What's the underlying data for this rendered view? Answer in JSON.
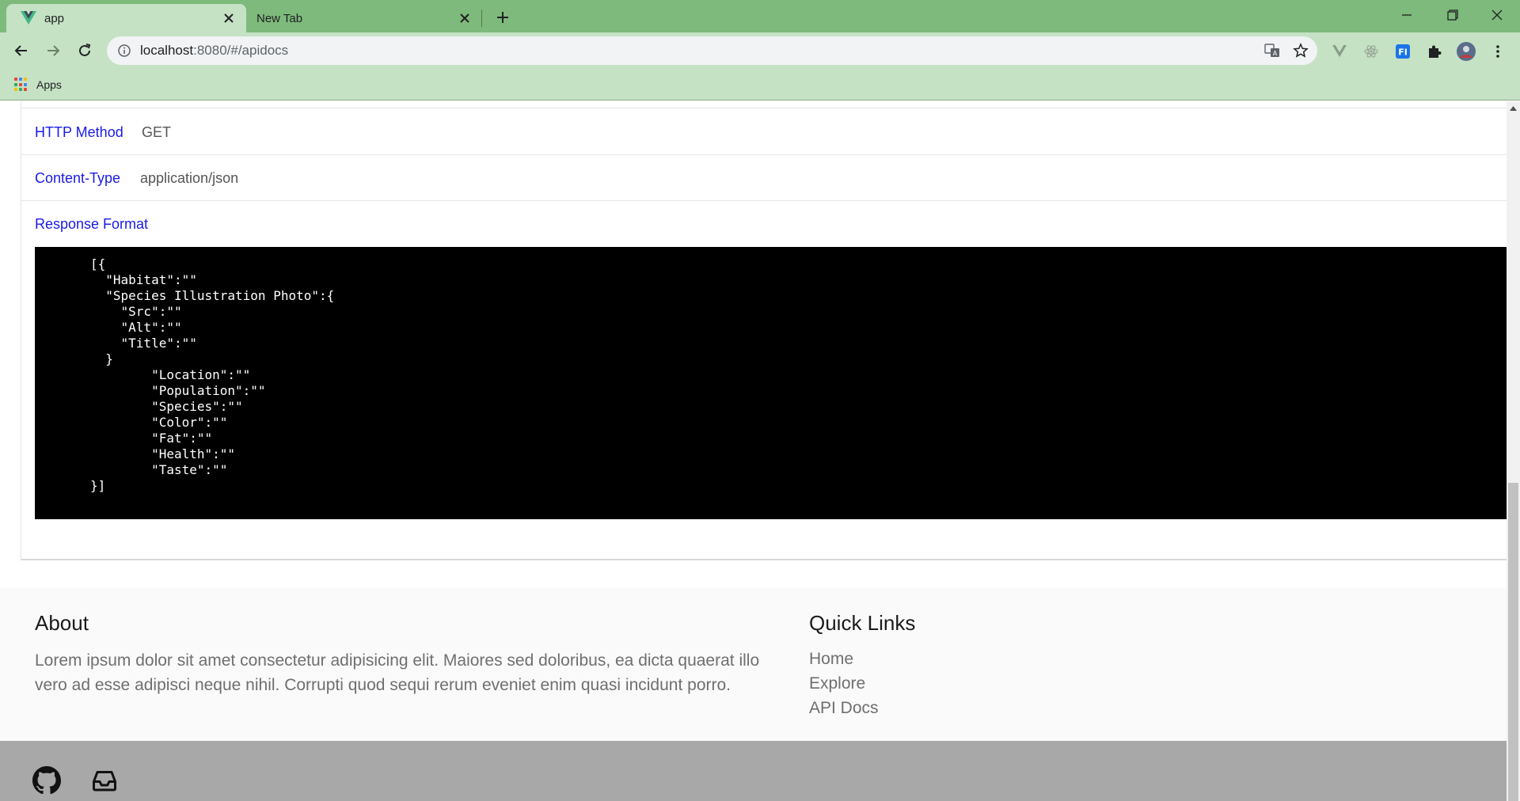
{
  "browser": {
    "tabs": [
      {
        "title": "app",
        "active": true
      },
      {
        "title": "New Tab",
        "active": false
      }
    ],
    "url_host": "localhost",
    "url_rest": ":8080/#/apidocs",
    "bookmarks": {
      "apps_label": "Apps"
    },
    "colors": {
      "frame": "#7dba7b",
      "toolbar": "#c5e2c4"
    }
  },
  "api": {
    "http_method_label": "HTTP Method",
    "http_method_value": "GET",
    "content_type_label": "Content-Type",
    "content_type_value": "application/json",
    "response_format_label": "Response Format",
    "response_code": "[{\n  \"Habitat\":\"\"\n  \"Species Illustration Photo\":{\n    \"Src\":\"\"\n    \"Alt\":\"\"\n    \"Title\":\"\"\n  }\n        \"Location\":\"\"\n        \"Population\":\"\"\n        \"Species\":\"\"\n        \"Color\":\"\"\n        \"Fat\":\"\"\n        \"Health\":\"\"\n        \"Taste\":\"\"\n}]"
  },
  "footer": {
    "about_heading": "About",
    "about_text": "Lorem ipsum dolor sit amet consectetur adipisicing elit. Maiores sed doloribus, ea dicta quaerat illo vero ad esse adipisci neque nihil. Corrupti quod sequi rerum eveniet enim quasi incidunt porro.",
    "quick_links_heading": "Quick Links",
    "quick_links": [
      "Home",
      "Explore",
      "API Docs"
    ],
    "social_icons": [
      "github-icon",
      "inbox-icon"
    ]
  }
}
